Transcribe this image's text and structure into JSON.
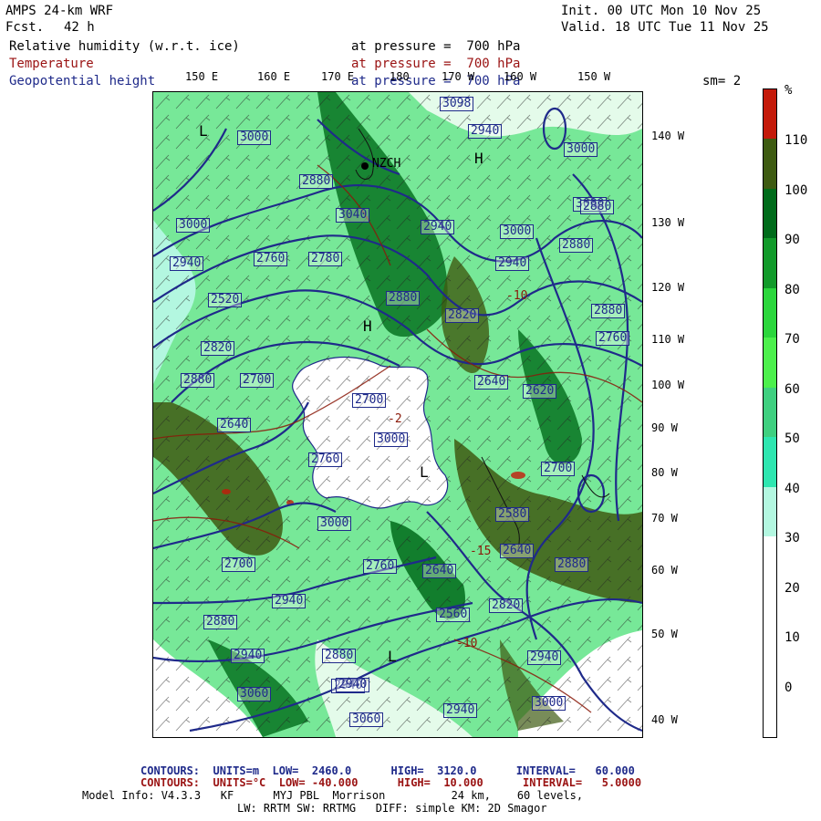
{
  "header": {
    "model": "AMPS 24-km WRF",
    "fcst_label": "Fcst.",
    "fcst_value": "42 h",
    "init": "Init. 00 UTC Mon 10 Nov 25",
    "valid": "Valid. 18 UTC Tue 11 Nov 25",
    "fields": [
      {
        "name": "Relative humidity (w.r.t. ice)",
        "level": "at pressure =  700 hPa",
        "color": "#000000"
      },
      {
        "name": "Temperature",
        "level": "at pressure =  700 hPa",
        "color": "#9a1212"
      },
      {
        "name": "Geopotential height",
        "level": "at pressure =  700 hPa",
        "color": "#1f2a8a"
      }
    ],
    "smoothing": "sm= 2"
  },
  "longitude_labels_top": [
    "150 E",
    "160 E",
    "170 E",
    "180",
    "170 W",
    "160 W",
    "150 W"
  ],
  "longitude_labels_right": [
    "140 W",
    "130 W",
    "120 W",
    "110 W",
    "100 W",
    "90 W",
    "80 W",
    "70 W",
    "60 W",
    "50 W",
    "40 W"
  ],
  "map": {
    "station_label": "NZCH",
    "height_labels": [
      "3098",
      "3000",
      "2880",
      "3040",
      "2940",
      "3000",
      "3000",
      "2880",
      "2940",
      "2760",
      "2780",
      "3000",
      "2940",
      "2820",
      "2880",
      "2700",
      "2640",
      "2520",
      "2880",
      "2820",
      "2880",
      "2760",
      "2700",
      "2640",
      "2620",
      "2760",
      "3000",
      "2700",
      "2580",
      "2640",
      "2880",
      "3000",
      "2700",
      "2940",
      "2760",
      "2640",
      "2560",
      "2820",
      "2880",
      "2940",
      "2880",
      "2940",
      "2940",
      "3000",
      "2880",
      "3000",
      "3060",
      "2940",
      "2940",
      "3060",
      "2940"
    ],
    "temperature_labels": [
      "-2",
      "-15",
      "-10",
      "-10"
    ],
    "pressure_markers": [
      {
        "type": "L",
        "text": "L"
      },
      {
        "type": "H",
        "text": "H"
      },
      {
        "type": "H",
        "text": "H"
      },
      {
        "type": "L",
        "text": "L"
      },
      {
        "type": "L",
        "text": "L"
      }
    ]
  },
  "colorbar": {
    "unit": "%",
    "ticks": [
      "110",
      "100",
      "90",
      "80",
      "70",
      "60",
      "50",
      "40",
      "30",
      "20",
      "10",
      "0"
    ],
    "colors": [
      "#c41a0a",
      "#3e5b12",
      "#006b1a",
      "#129a2a",
      "#2bd63c",
      "#4cf04c",
      "#3fd080",
      "#2ee6b0",
      "#b3f7e0",
      "#ffffff",
      "#ffffff",
      "#ffffff",
      "#ffffff"
    ]
  },
  "footer": {
    "contours1": "CONTOURS:  UNITS=m  LOW=  2460.0      HIGH=  3120.0      INTERVAL=   60.000",
    "contours2": "CONTOURS:  UNITS=°C  LOW= -40.000      HIGH=  10.000      INTERVAL=   5.0000",
    "model_info": "Model Info: V4.3.3   KF      MYJ PBL  Morrison          24 km,    60 levels,",
    "physics": "LW: RRTM SW: RRTMG   DIFF: simple KM: 2D Smagor"
  }
}
